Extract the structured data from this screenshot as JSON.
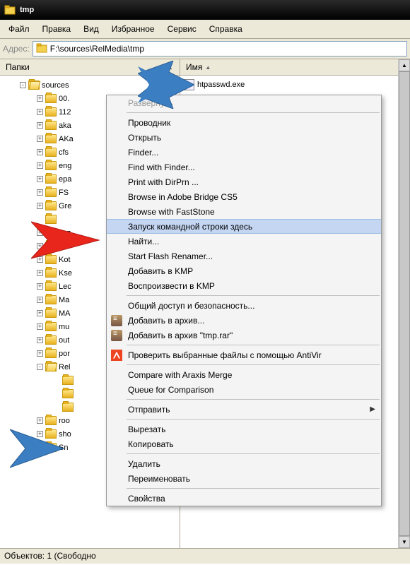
{
  "window": {
    "title": "tmp"
  },
  "menubar": {
    "items": [
      "Файл",
      "Правка",
      "Вид",
      "Избранное",
      "Сервис",
      "Справка"
    ]
  },
  "addressbar": {
    "label": "Адрес:",
    "path": "F:\\sources\\RelMedia\\tmp"
  },
  "folders_pane": {
    "title": "Папки"
  },
  "tree": {
    "root": "sources",
    "items": [
      "00.",
      "112",
      "aka",
      "AKa",
      "cfs",
      "eng",
      "epa",
      "FS",
      "Gre",
      "-",
      "Jaz",
      "Kin",
      "Kot",
      "Kse",
      "Lec",
      "Ma",
      "MA",
      "mu",
      "out",
      "por",
      "Rel"
    ],
    "sub": [
      "",
      "",
      ""
    ],
    "tail": [
      "roo",
      "sho",
      "Sn"
    ]
  },
  "list": {
    "header": "Имя",
    "file": "htpasswd.exe"
  },
  "context_menu": {
    "items": [
      {
        "label": "Развернуть",
        "disabled": true
      },
      {
        "sep": true
      },
      {
        "label": "Проводник"
      },
      {
        "label": "Открыть"
      },
      {
        "label": "Finder..."
      },
      {
        "label": "Find with Finder..."
      },
      {
        "label": "Print with DirPrn ..."
      },
      {
        "label": "Browse in Adobe Bridge CS5"
      },
      {
        "label": "Browse with FastStone"
      },
      {
        "label": "Запуск командной строки здесь",
        "hover": true
      },
      {
        "label": "Найти..."
      },
      {
        "label": "Start Flash Renamer..."
      },
      {
        "label": "Добавить в KMP"
      },
      {
        "label": "Воспроизвести в KMP"
      },
      {
        "sep": true
      },
      {
        "label": "Общий доступ и безопасность..."
      },
      {
        "label": "Добавить в архив...",
        "icon": "archive"
      },
      {
        "label": "Добавить в архив \"tmp.rar\"",
        "icon": "archive"
      },
      {
        "sep": true
      },
      {
        "label": "Проверить выбранные файлы с помощью AntiVir",
        "icon": "avira"
      },
      {
        "sep": true
      },
      {
        "label": "Compare with Araxis Merge"
      },
      {
        "label": "Queue for Comparison"
      },
      {
        "sep": true
      },
      {
        "label": "Отправить",
        "submenu": true
      },
      {
        "sep": true
      },
      {
        "label": "Вырезать"
      },
      {
        "label": "Копировать"
      },
      {
        "sep": true
      },
      {
        "label": "Удалить"
      },
      {
        "label": "Переименовать"
      },
      {
        "sep": true
      },
      {
        "label": "Свойства"
      }
    ]
  },
  "statusbar": {
    "text": "Объектов: 1 (Свободно"
  }
}
